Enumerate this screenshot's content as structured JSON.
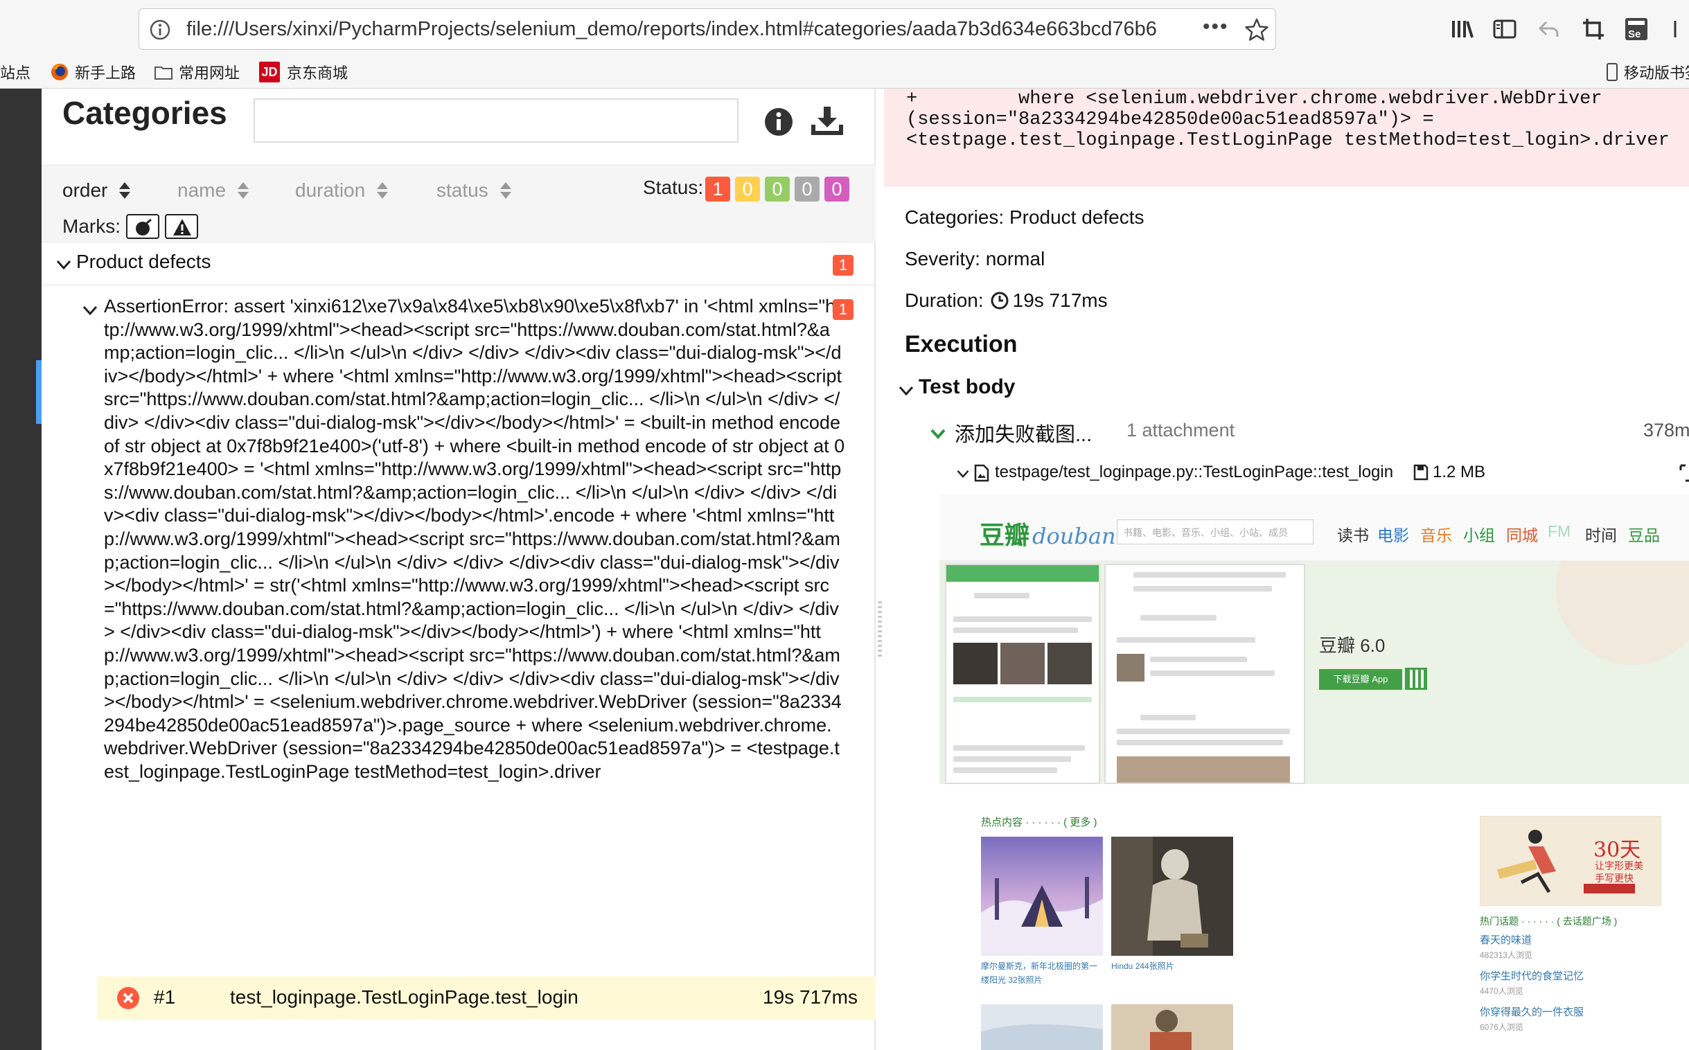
{
  "browser": {
    "url": "file:///Users/xinxi/PycharmProjects/selenium_demo/reports/index.html#categories/aada7b3d634e663bcd76b6",
    "more_label": "•••",
    "bookmarks": [
      {
        "label": "站点"
      },
      {
        "label": "新手上路"
      },
      {
        "label": "常用网址"
      },
      {
        "label": "京东商城"
      }
    ],
    "jd_logo_text": "JD",
    "mobile_bookmarks": "移动版书签"
  },
  "left": {
    "title": "Categories",
    "search_placeholder": "",
    "sort": [
      "order",
      "name",
      "duration",
      "status"
    ],
    "status_label": "Status:",
    "status_counts": [
      {
        "value": "1",
        "color": "#fd5a3e"
      },
      {
        "value": "0",
        "color": "#ffd050"
      },
      {
        "value": "0",
        "color": "#97cc64"
      },
      {
        "value": "0",
        "color": "#aaaaaa"
      },
      {
        "value": "0",
        "color": "#d35ebe"
      }
    ],
    "marks_label": "Marks:",
    "group": {
      "name": "Product defects",
      "count": "1"
    },
    "error": {
      "count": "1",
      "text": "AssertionError: assert 'xinxi612\\xe7\\x9a\\x84\\xe5\\xb8\\x90\\xe5\\x8f\\xb7' in '<html xmlns=\"http://www.w3.org/1999/xhtml\"><head><script src=\"https://www.douban.com/stat.html?&amp;action=login_clic... </li>\\n </ul>\\n </div> </div> </div><div class=\"dui-dialog-msk\"></div></body></html>' + where '<html xmlns=\"http://www.w3.org/1999/xhtml\"><head><script src=\"https://www.douban.com/stat.html?&amp;action=login_clic... </li>\\n </ul>\\n </div> </div> </div><div class=\"dui-dialog-msk\"></div></body></html>' = <built-in method encode of str object at 0x7f8b9f21e400>('utf-8') + where <built-in method encode of str object at 0x7f8b9f21e400> = '<html xmlns=\"http://www.w3.org/1999/xhtml\"><head><script src=\"https://www.douban.com/stat.html?&amp;action=login_clic... </li>\\n </ul>\\n </div> </div> </div><div class=\"dui-dialog-msk\"></div></body></html>'.encode + where '<html xmlns=\"http://www.w3.org/1999/xhtml\"><head><script src=\"https://www.douban.com/stat.html?&amp;action=login_clic... </li>\\n </ul>\\n </div> </div> </div><div class=\"dui-dialog-msk\"></div></body></html>' = str('<html xmlns=\"http://www.w3.org/1999/xhtml\"><head><script src=\"https://www.douban.com/stat.html?&amp;action=login_clic... </li>\\n </ul>\\n </div> </div> </div><div class=\"dui-dialog-msk\"></div></body></html>') + where '<html xmlns=\"http://www.w3.org/1999/xhtml\"><head><script src=\"https://www.douban.com/stat.html?&amp;action=login_clic... </li>\\n </ul>\\n </div> </div> </div><div class=\"dui-dialog-msk\"></div></body></html>' = <selenium.webdriver.chrome.webdriver.WebDriver (session=\"8a2334294be42850de00ac51ead8597a\")>.page_source + where <selenium.webdriver.chrome.webdriver.WebDriver (session=\"8a2334294be42850de00ac51ead8597a\")> = <testpage.test_loginpage.TestLoginPage testMethod=test_login>.driver"
    },
    "test": {
      "num": "#1",
      "name": "test_loginpage.TestLoginPage.test_login",
      "duration": "19s 717ms"
    }
  },
  "right": {
    "trace_lines": [
      "+         where <selenium.webdriver.chrome.webdriver.WebDriver",
      "(session=\"8a2334294be42850de00ac51ead8597a\")> =",
      "<testpage.test_loginpage.TestLoginPage testMethod=test_login>.driver"
    ],
    "categories": "Categories: Product defects",
    "severity": "Severity: normal",
    "duration_label": "Duration:",
    "duration_value": "19s 717ms",
    "execution": "Execution",
    "test_body": "Test body",
    "step": {
      "title": "添加失败截图...",
      "attachments": "1 attachment",
      "duration": "378m"
    },
    "attachment": {
      "name": "testpage/test_loginpage.py::TestLoginPage::test_login",
      "size": "1.2 MB"
    }
  },
  "douban": {
    "logo_cn": "豆瓣",
    "logo_en": "douban",
    "search_placeholder": "书籍、电影、音乐、小组、小站、成员",
    "nav": [
      {
        "label": "读书",
        "color": "#333333"
      },
      {
        "label": "电影",
        "color": "#2f77c4"
      },
      {
        "label": "音乐",
        "color": "#e57c22"
      },
      {
        "label": "小组",
        "color": "#2e963d"
      },
      {
        "label": "同城",
        "color": "#d8582c"
      },
      {
        "label": "FM",
        "color": "#a8d8b8"
      },
      {
        "label": "时间",
        "color": "#333333"
      },
      {
        "label": "豆品",
        "color": "#2e963d"
      }
    ],
    "app_title": "豆瓣 6.0",
    "app_button": "下载豆瓣 App",
    "hot_label": "热点内容  · · · · · ·  ( 更多 )",
    "captions": [
      "摩尔曼斯克，新年北极圈的第一",
      "缕阳光 32张照片",
      "Hindu 244张照片"
    ],
    "ad_title": "30天",
    "ad_sub": "让字形更美\n手写更快",
    "topics_label": "热门话题  · · · · · ·  ( 去话题广场 )",
    "topics": [
      {
        "title": "春天的味道",
        "views": "482313人浏览"
      },
      {
        "title": "你学生时代的食堂记忆",
        "views": "4470人浏览"
      },
      {
        "title": "你穿得最久的一件衣服",
        "views": "6076人浏览"
      }
    ]
  }
}
